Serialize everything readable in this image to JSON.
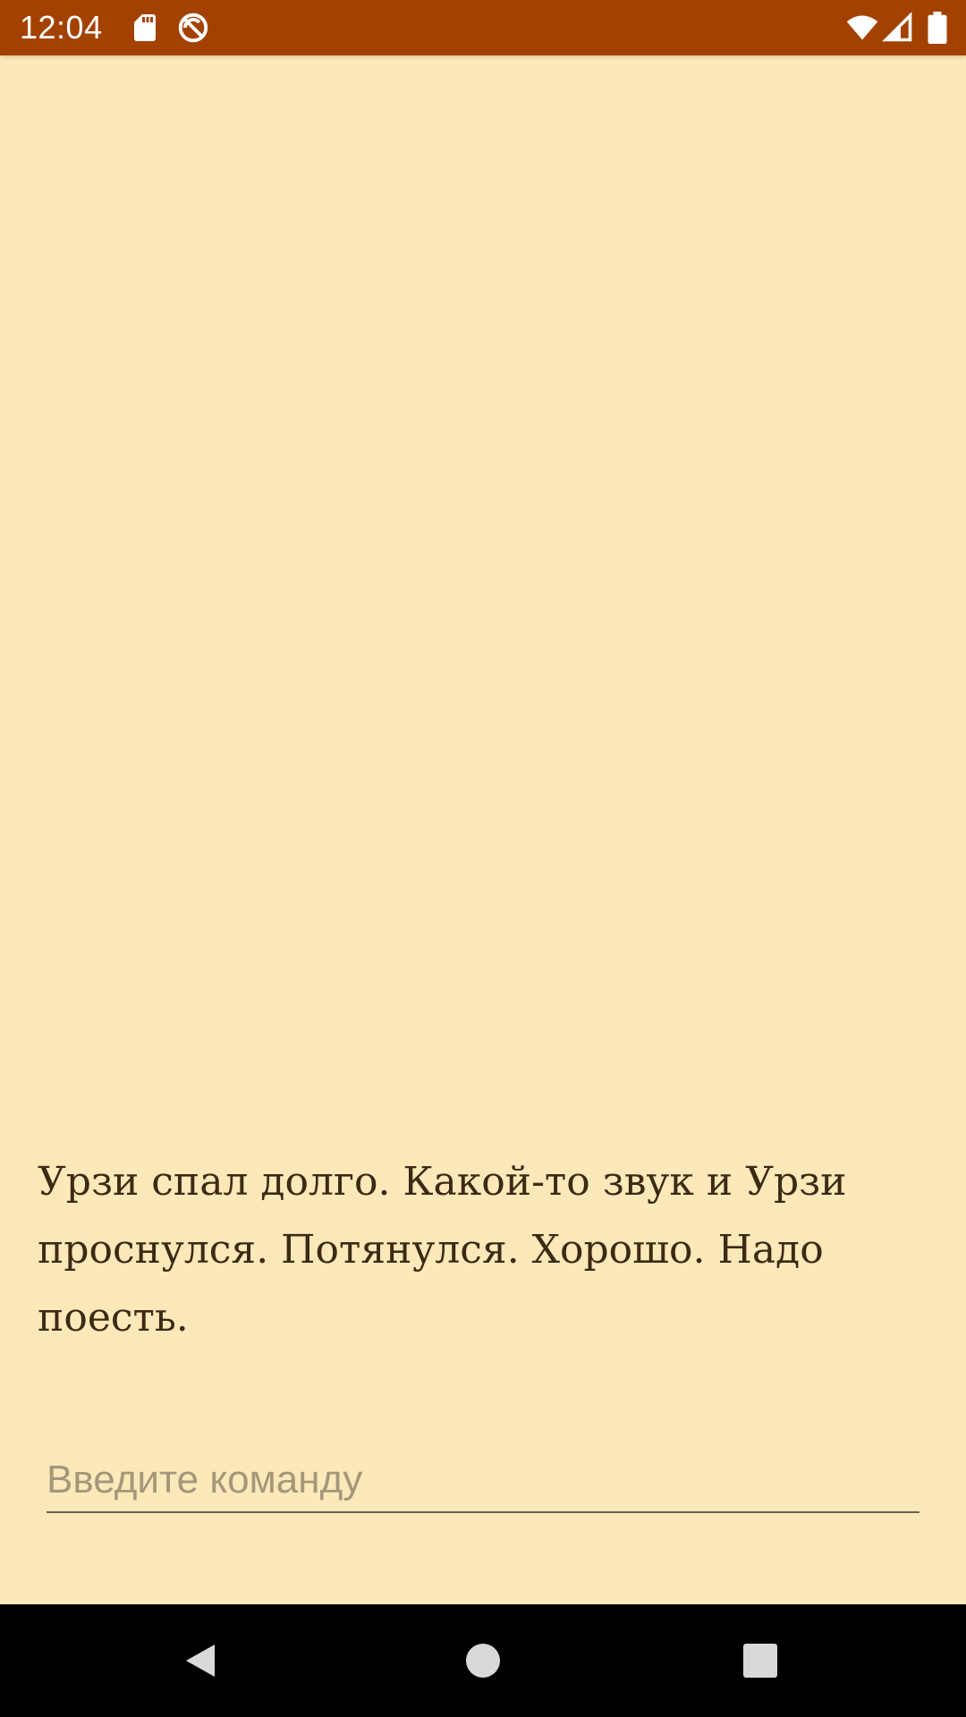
{
  "status_bar": {
    "time": "12:04",
    "background_color": "#a34200",
    "icons": [
      "sd-card-icon",
      "do-not-disturb-icon",
      "wifi-icon",
      "cell-signal-icon",
      "battery-icon"
    ]
  },
  "story": {
    "text": "Урзи спал долго. Какой-то звук и Урзи проснулся. Потянулся. Хорошо. Надо поесть."
  },
  "command": {
    "value": "",
    "placeholder": "Введите команду"
  },
  "nav_bar": {
    "icons": [
      "back-icon",
      "home-icon",
      "recents-icon"
    ]
  },
  "colors": {
    "background": "#fce9b9",
    "text": "#3d2a14",
    "status_bar": "#a34200"
  }
}
